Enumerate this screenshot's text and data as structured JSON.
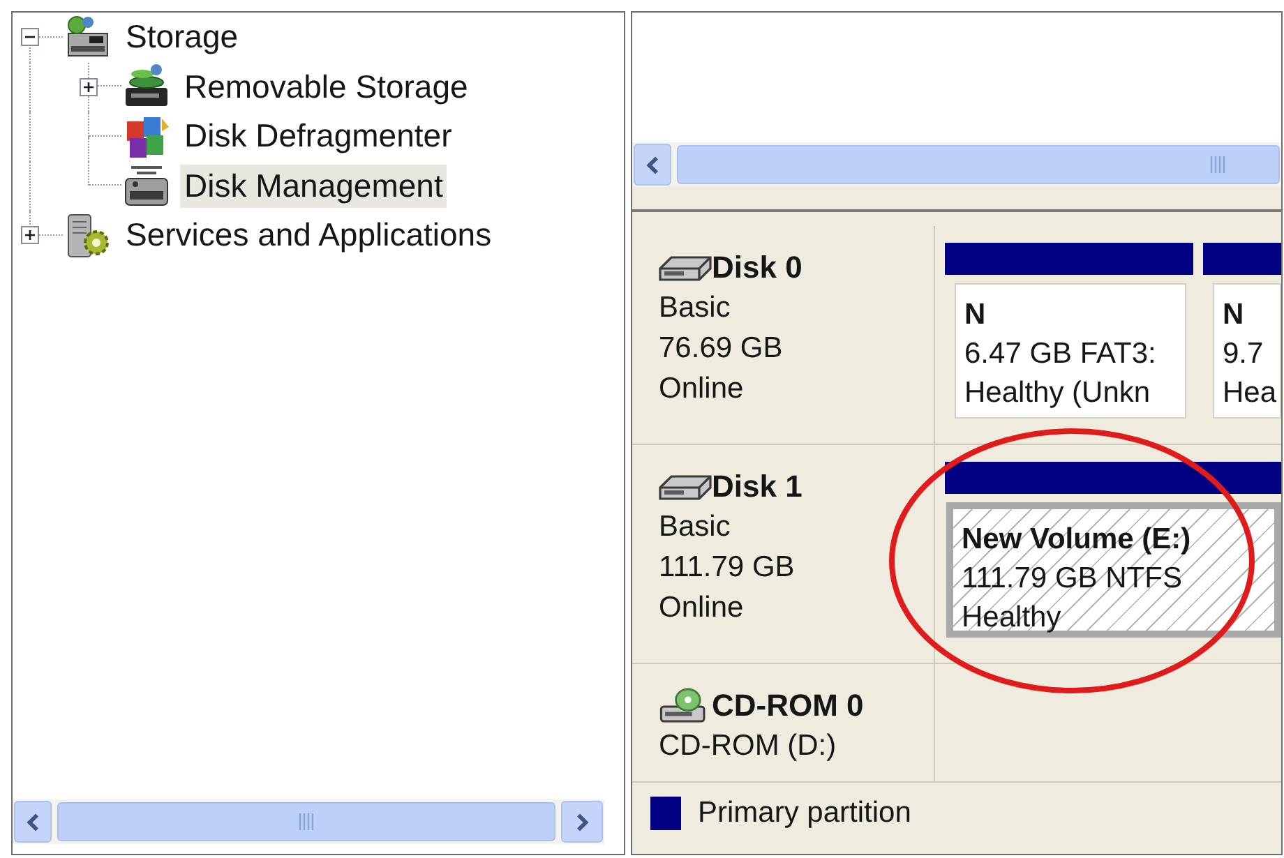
{
  "tree": [
    {
      "label": "Storage",
      "expanded": true,
      "selected": false,
      "children": [
        {
          "label": "Removable Storage",
          "expanded": false,
          "selected": false
        },
        {
          "label": "Disk Defragmenter",
          "selected": false
        },
        {
          "label": "Disk Management",
          "selected": true
        }
      ]
    },
    {
      "label": "Services and Applications",
      "expanded": false,
      "selected": false
    }
  ],
  "disks": [
    {
      "kind": "disk",
      "name": "Disk 0",
      "details": [
        "Basic",
        "76.69 GB",
        "Online"
      ],
      "partitions": [
        {
          "title": "N",
          "details": [
            "6.47 GB FAT3:",
            "Healthy (Unkn"
          ],
          "selected": false
        },
        {
          "title": "N",
          "details": [
            "9.7",
            "Hea"
          ],
          "selected": false
        }
      ]
    },
    {
      "kind": "disk",
      "name": "Disk 1",
      "details": [
        "Basic",
        "111.79 GB",
        "Online"
      ],
      "partitions": [
        {
          "title": "New Volume (E:)",
          "details": [
            "111.79 GB NTFS",
            "Healthy"
          ],
          "selected": true
        }
      ]
    },
    {
      "kind": "cdrom",
      "name": "CD-ROM 0",
      "details": [
        "CD-ROM (D:)"
      ]
    }
  ],
  "legend": [
    {
      "label": "Primary partition",
      "color": "#000080"
    }
  ]
}
